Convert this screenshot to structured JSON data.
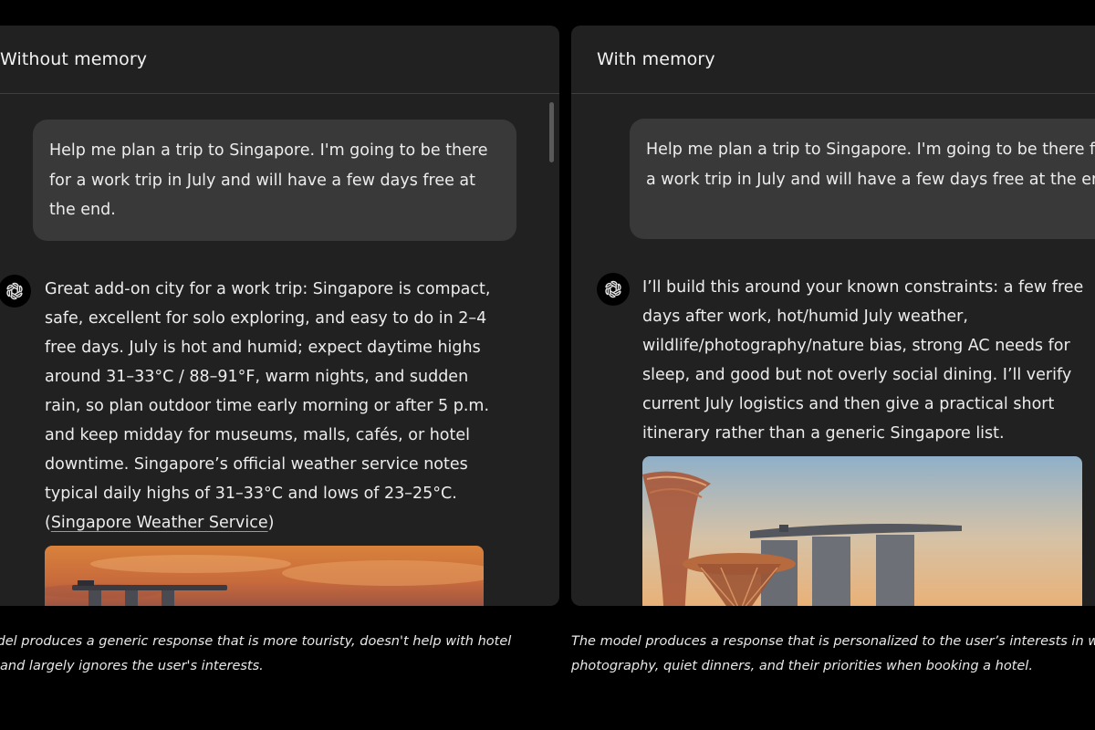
{
  "left_panel": {
    "title": "Without memory",
    "user_message": "Help me plan a trip to Singapore. I'm going to be there for a work trip in July and will have a few days free at the end.",
    "assistant_text": "Great add-on city for a work trip: Singapore is compact, safe, excellent for solo exploring, and easy to do in 2–4 free days. July is hot and humid; expect daytime highs around 31–33°C / 88–91°F, warm nights, and sudden rain, so plan outdoor time early morning or after 5 p.m. and keep midday for museums, malls, cafés, or hotel downtime. Singapore’s official weather service notes typical daily highs of 31–33°C and lows of 23–25°C. (",
    "citation_link": "Singapore Weather Service",
    "citation_close": ")",
    "caption_line1": "e model produces a generic response that is more touristy, doesn't help with hotel",
    "caption_line2": "king, and largely ignores the user's interests."
  },
  "right_panel": {
    "title": "With memory",
    "user_message": "Help me plan a trip to Singapore. I'm going to be there for a work trip in July and will have a few days free at the end.",
    "assistant_text": "I’ll build this around your known constraints: a few free days after work, hot/humid July weather, wildlife/photography/nature bias, strong AC needs for sleep, and good but not overly social dining. I’ll verify current July logistics and then give a practical short itinerary rather than a generic Singapore list.",
    "caption_line1": "The model produces a response that is personalized to the user’s interests in w",
    "caption_line2": "photography, quiet dinners, and their priorities when booking a hotel."
  },
  "icons": {
    "assistant_avatar": "openai-logo-icon"
  },
  "colors": {
    "page_background": "#000000",
    "panel_background": "#212121",
    "user_bubble": "#393939",
    "text": "#ececec"
  }
}
